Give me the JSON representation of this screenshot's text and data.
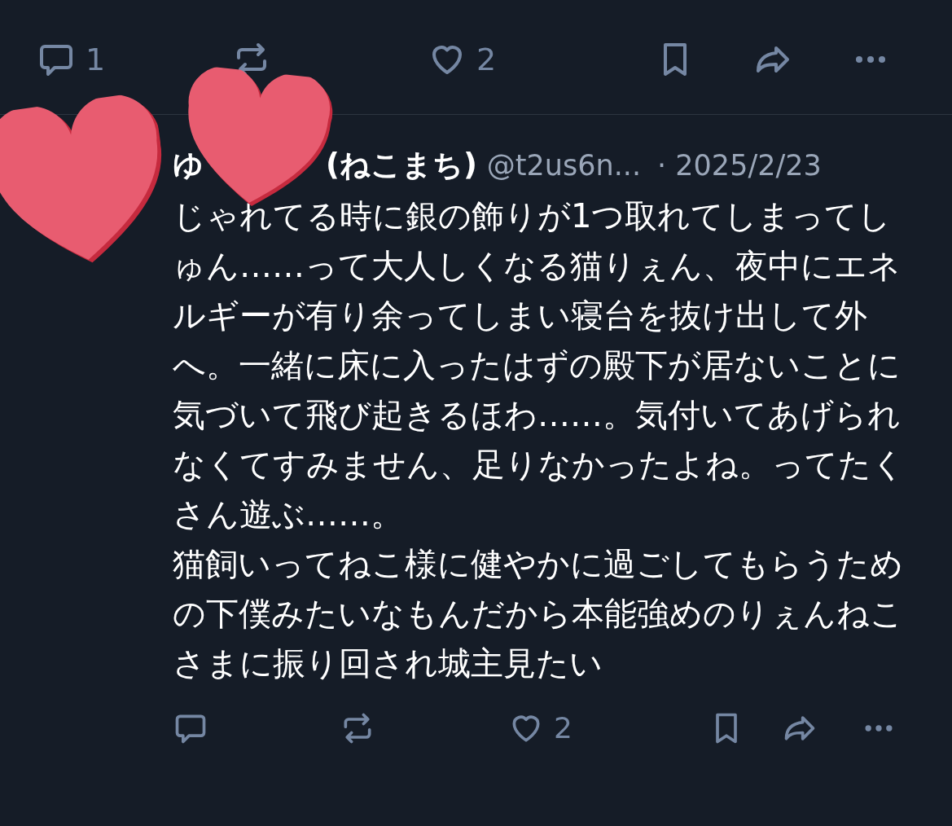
{
  "post_actions": [
    {
      "kind": "reply",
      "count": "1"
    },
    {
      "kind": "repost"
    },
    {
      "kind": "like",
      "count": "2"
    },
    {
      "kind": "bookmark"
    },
    {
      "kind": "share"
    },
    {
      "kind": "more"
    }
  ],
  "reply": {
    "name_start": "ゆ",
    "name_end": "(ねこまち)",
    "handle": "@t2us6n...",
    "date": "· 2025/2/23",
    "paragraphs": [
      "じゃれてる時に銀の飾りが1つ取れてしまってしゅん……って大人しくなる猫りぇん、夜中にエネルギーが有り余ってしまい寝台を抜け出して外へ。一緒に床に入ったはずの殿下が居ないことに気づいて飛び起きるほわ……。気付いてあげられなくてすみません、足りなかったよね。ってたくさん遊ぶ……。",
      "猫飼いってねこ様に健やかに過ごしてもらうための下僕みたいなもんだから本能強めのりぇんねこさまに振り回され城主見たい"
    ],
    "actions": [
      {
        "kind": "reply"
      },
      {
        "kind": "repost"
      },
      {
        "kind": "like",
        "count": "2"
      },
      {
        "kind": "bookmark"
      },
      {
        "kind": "share"
      },
      {
        "kind": "more"
      }
    ]
  }
}
